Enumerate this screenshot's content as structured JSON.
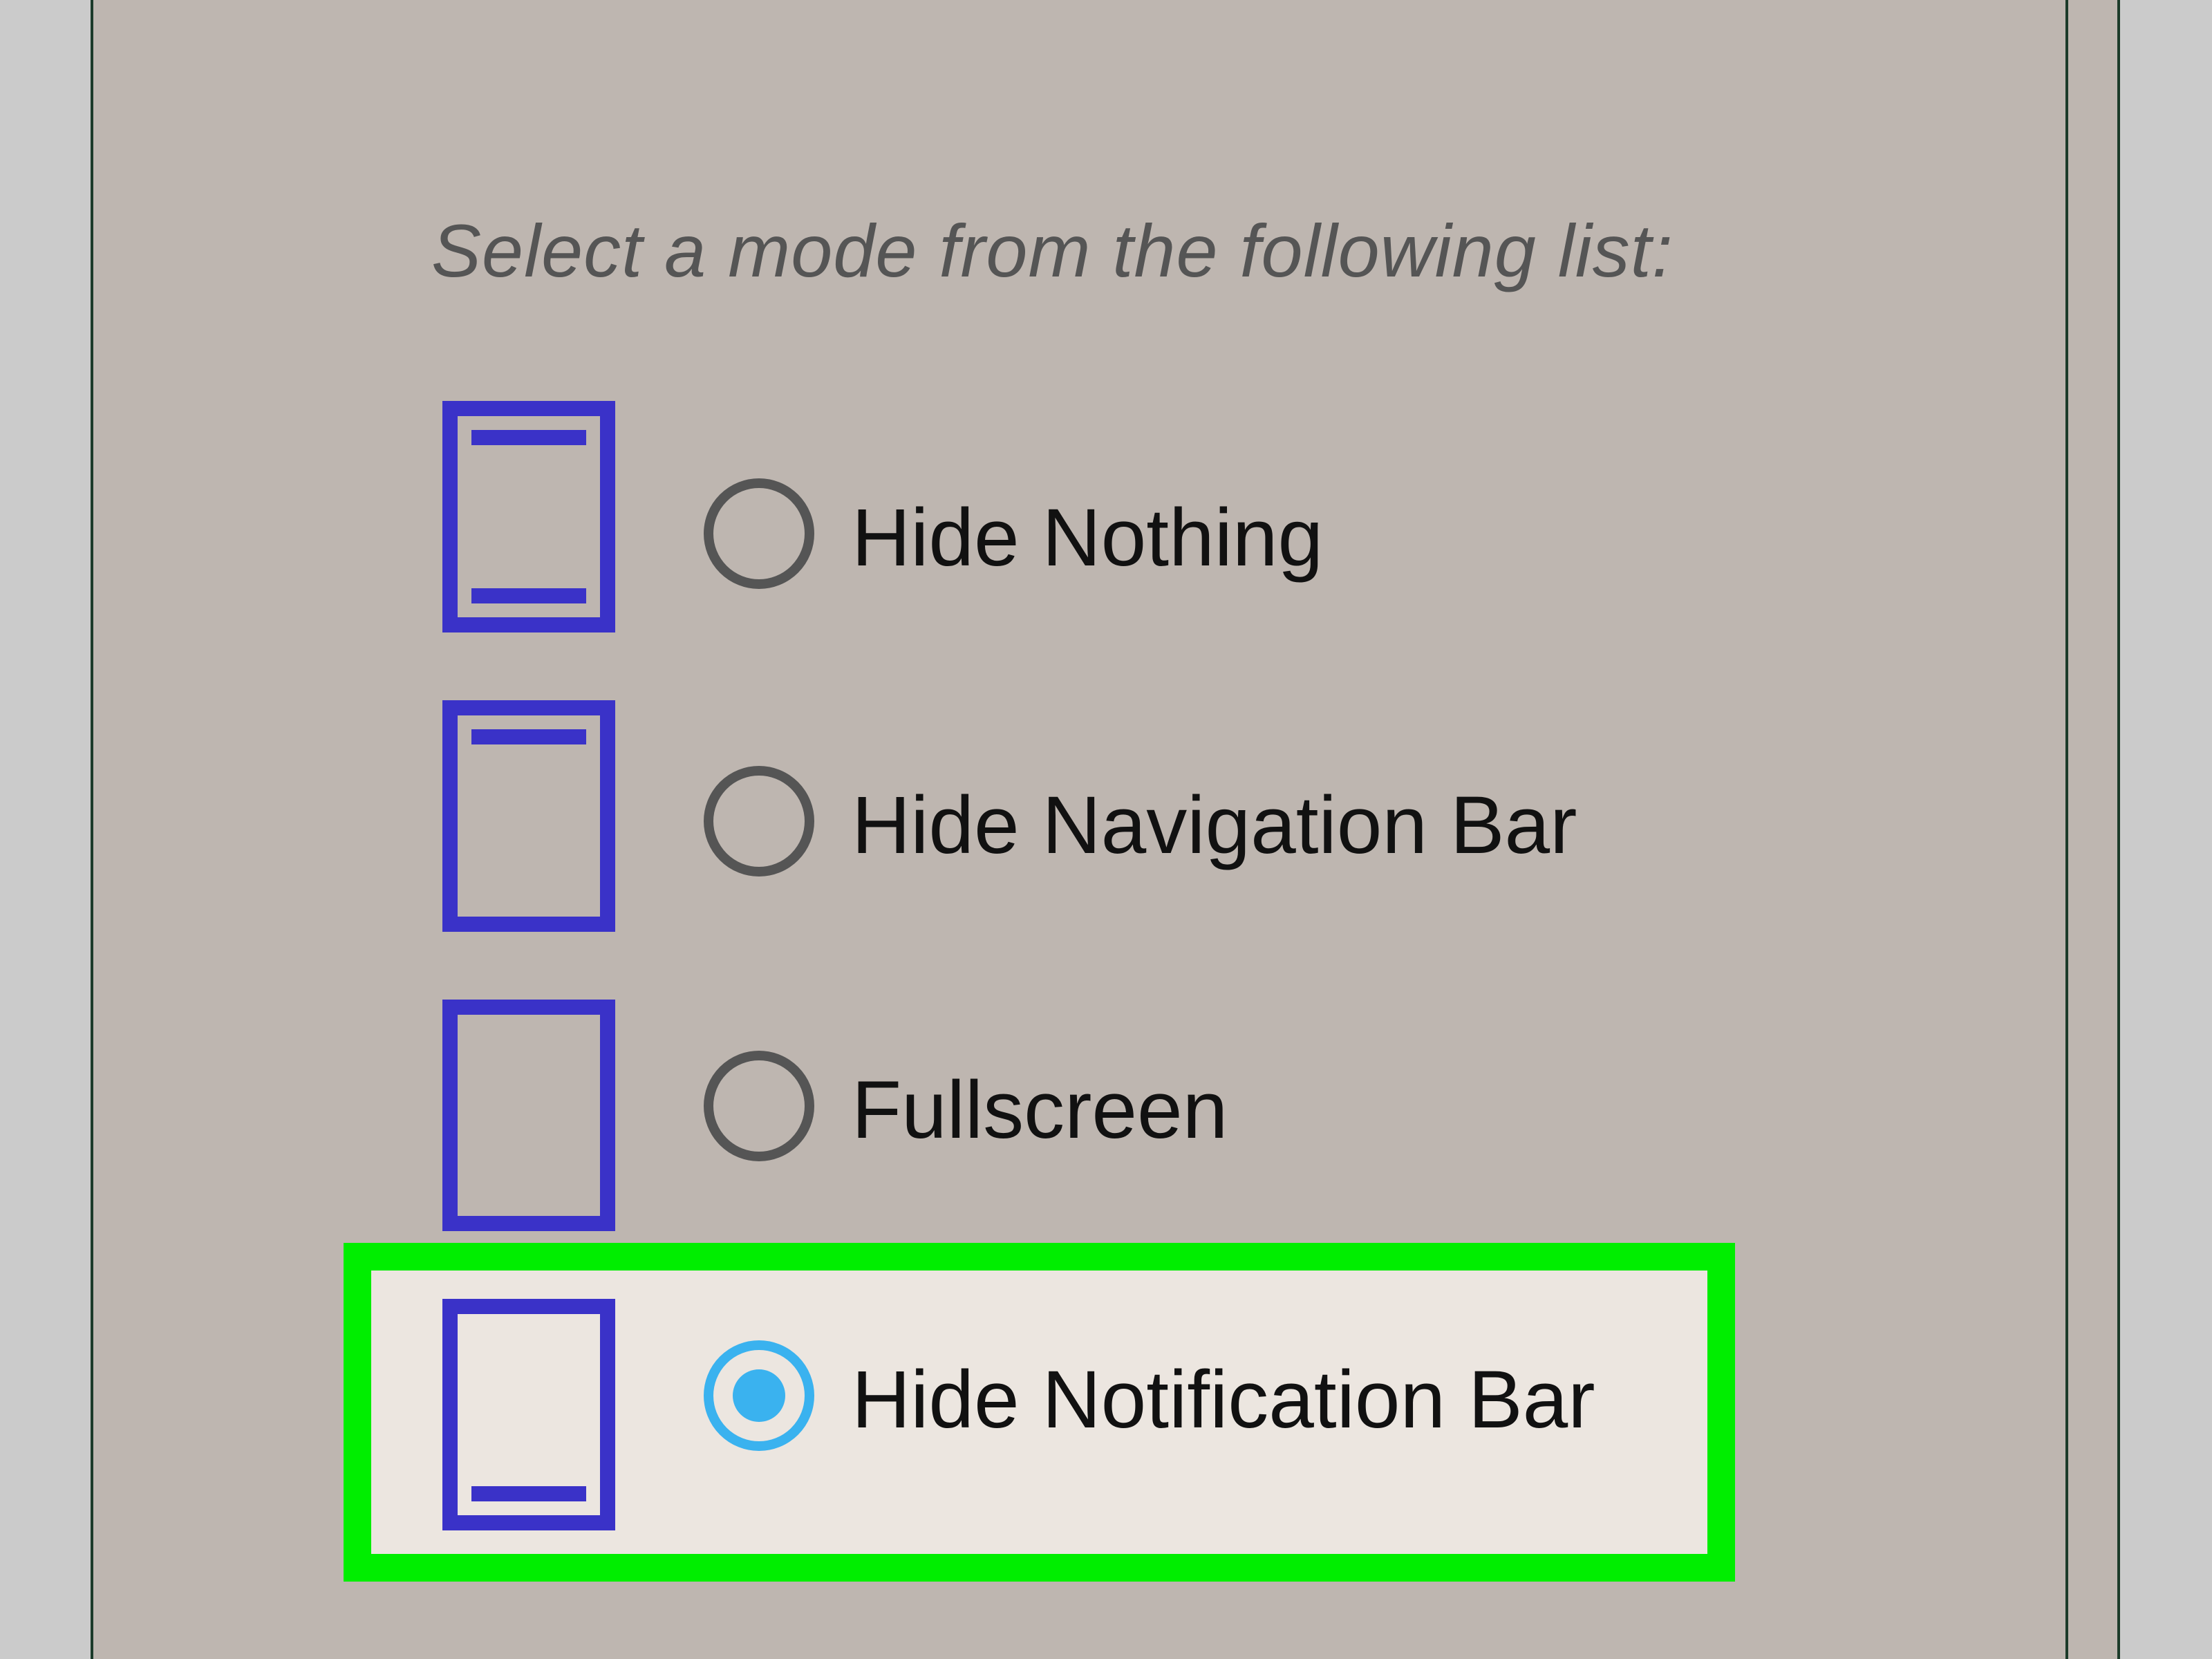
{
  "prompt": {
    "text": "Select a mode from the following list:"
  },
  "options": [
    {
      "label": "Hide Nothing",
      "icon": "phone-status-and-nav-bars-icon",
      "selected": false
    },
    {
      "label": "Hide Navigation Bar",
      "icon": "phone-status-bar-only-icon",
      "selected": false
    },
    {
      "label": "Fullscreen",
      "icon": "phone-fullscreen-icon",
      "selected": false
    },
    {
      "label": "Hide Notification Bar",
      "icon": "phone-nav-bar-only-icon",
      "selected": true
    }
  ],
  "colors": {
    "panel_background": "#beb6b0",
    "icon_blue": "#3a32c8",
    "radio_selected": "#3ab2ef",
    "highlight_green": "#00ee00",
    "selected_row_background": "#ece6e0"
  }
}
